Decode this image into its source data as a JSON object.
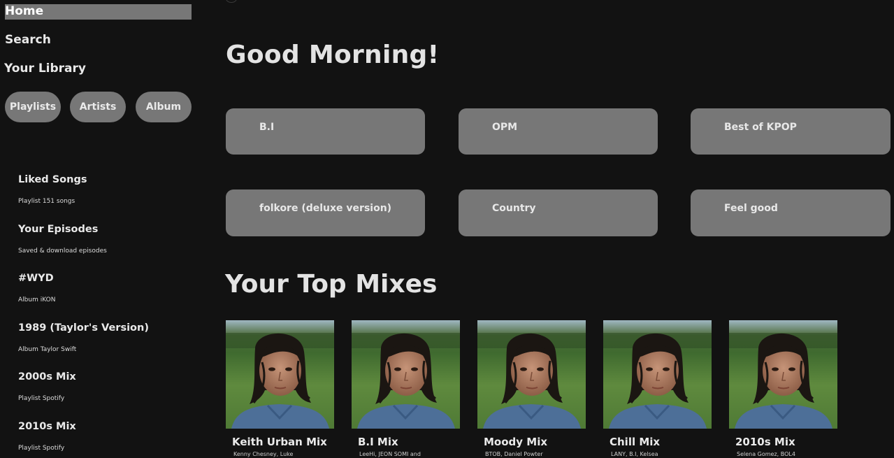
{
  "sidebar": {
    "nav": {
      "home": "Home",
      "search": "Search",
      "library": "Your Library"
    },
    "filters": [
      "Playlists",
      "Artists",
      "Album"
    ],
    "library_items": [
      {
        "title": "Liked Songs",
        "subtitle": "Playlist 151 songs"
      },
      {
        "title": "Your Episodes",
        "subtitle": "Saved & download episodes"
      },
      {
        "title": "#WYD",
        "subtitle": "Album iKON"
      },
      {
        "title": "1989 (Taylor's Version)",
        "subtitle": "Album Taylor Swift"
      },
      {
        "title": "2000s Mix",
        "subtitle": "Playlist Spotify"
      },
      {
        "title": "2010s Mix",
        "subtitle": "Playlist Spotify"
      }
    ]
  },
  "main": {
    "greeting": "Good Morning!",
    "quick_picks": [
      "B.I",
      "OPM",
      "Best of KPOP",
      "folkore (deluxe version)",
      "Country",
      "Feel good"
    ],
    "top_mixes_title": "Your Top Mixes",
    "mixes": [
      {
        "title": "Keith Urban Mix",
        "subtitle": "Kenny Chesney, Luke"
      },
      {
        "title": "B.I Mix",
        "subtitle": "LeeHi, JEON SOMI and"
      },
      {
        "title": "Moody Mix",
        "subtitle": "BTOB, Daniel Powter"
      },
      {
        "title": "Chill Mix",
        "subtitle": "LANY, B.I, Kelsea"
      },
      {
        "title": "2010s Mix",
        "subtitle": "Selena Gomez, BOL4"
      }
    ]
  },
  "colors": {
    "background": "#121212",
    "surface": "#777777",
    "text": "#e6e6e6"
  }
}
